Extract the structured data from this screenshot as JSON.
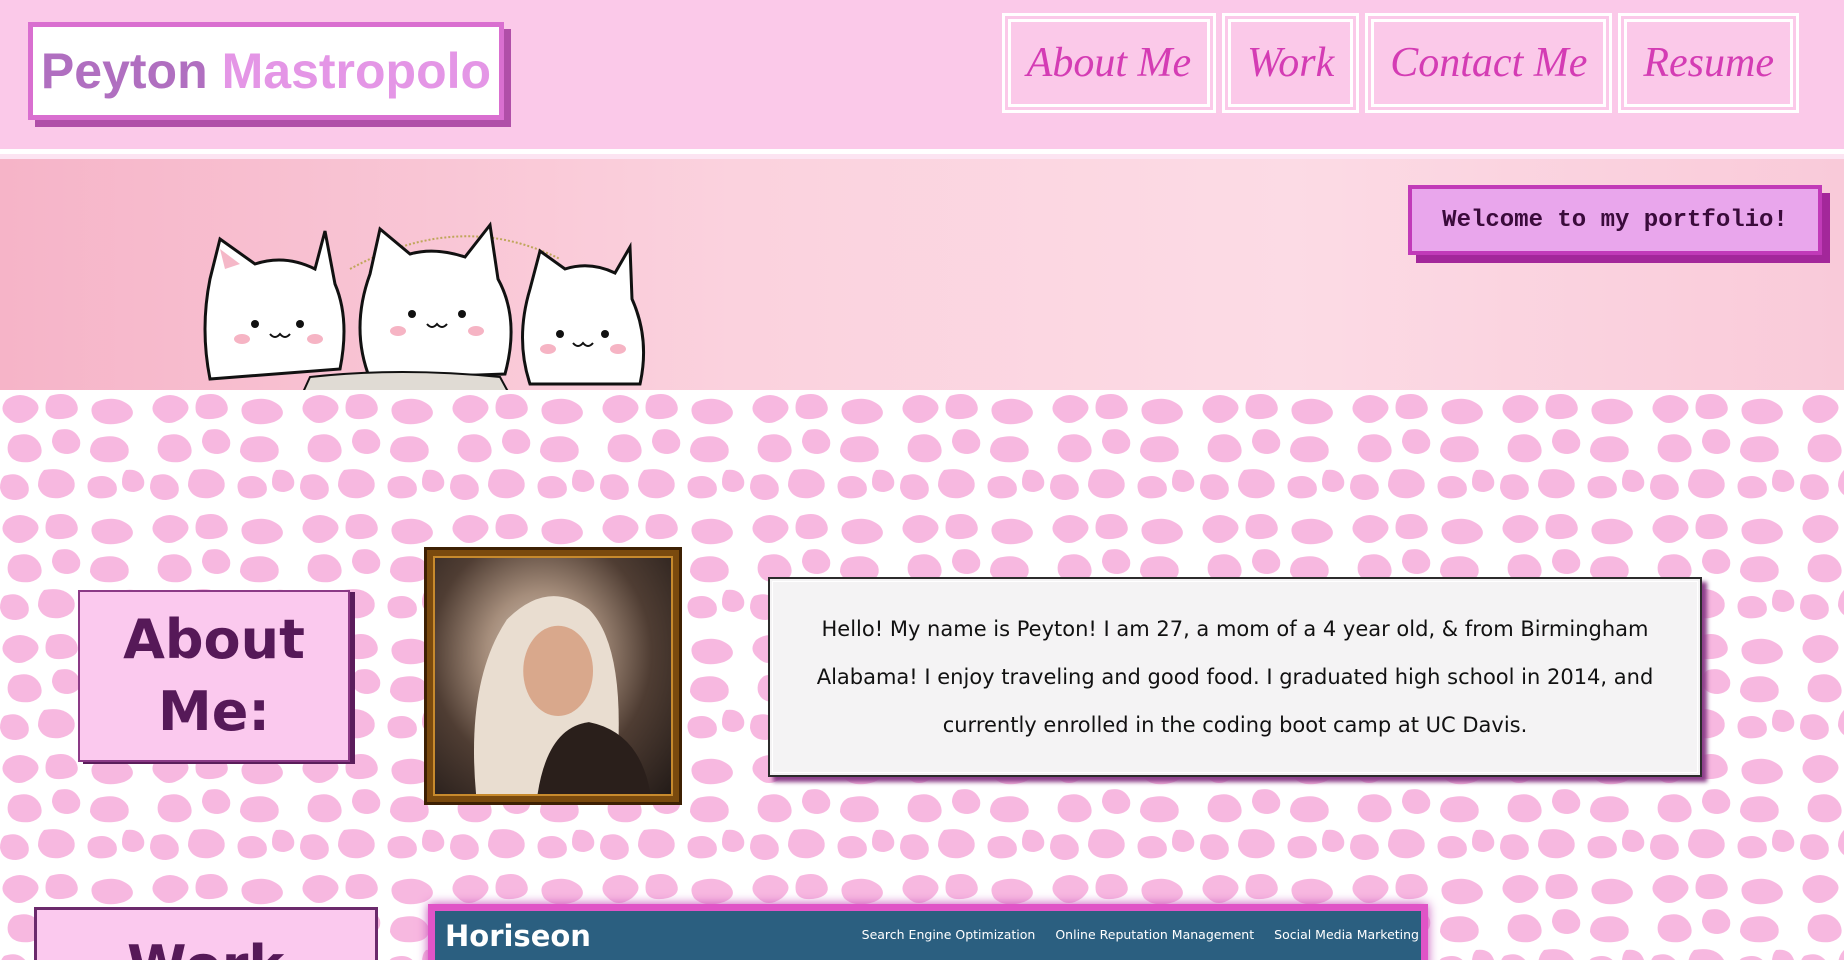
{
  "header": {
    "logo": {
      "first": "Peyton",
      "last": "Mastropolo"
    },
    "nav": [
      {
        "label": "About Me"
      },
      {
        "label": "Work"
      },
      {
        "label": "Contact Me"
      },
      {
        "label": "Resume"
      }
    ]
  },
  "banner": {
    "welcome": "Welcome to my portfolio!",
    "illustration": "three-cats-illustration"
  },
  "about": {
    "title_line1": "About",
    "title_line2": "Me:",
    "photo": "profile-photo",
    "bio": "Hello! My name is Peyton! I am 27, a mom of a 4 year old, & from Birmingham Alabama! I enjoy traveling and good food. I graduated high school in 2014, and currently enrolled in the coding boot camp at UC Davis."
  },
  "work": {
    "title": "Work",
    "project": {
      "brand": "Horiseon",
      "links": [
        "Search Engine Optimization",
        "Online Reputation Management",
        "Social Media Marketing"
      ]
    }
  },
  "colors": {
    "header_bg": "#fbc9e9",
    "nav_text": "#d43cb4",
    "accent_purple": "#561958",
    "pattern_pink": "#f7b8e0"
  }
}
